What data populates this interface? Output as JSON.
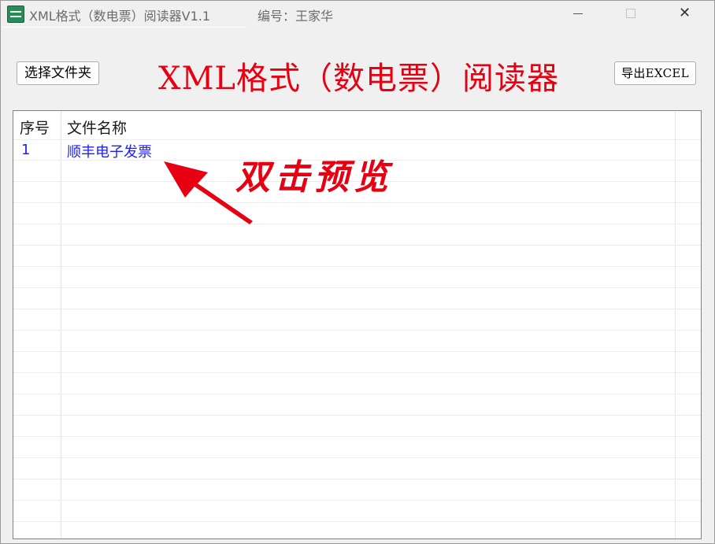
{
  "window": {
    "title": "XML格式（数电票）阅读器V1.1",
    "author": "编号：王家华",
    "controls": {
      "minimize": "—",
      "maximize": "□",
      "close": "✕"
    }
  },
  "toolbar": {
    "folder_button": "选择文件夹",
    "heading": "XML格式（数电票）阅读器",
    "export_button": "导出EXCEL"
  },
  "table": {
    "columns": [
      "序号",
      "文件名称"
    ],
    "rows": [
      {
        "no": "1",
        "name": "顺丰电子发票"
      }
    ]
  },
  "annotation": {
    "text": "双击预览",
    "color": "#e60012"
  },
  "icons": [
    "app-icon",
    "minimize-icon",
    "maximize-icon",
    "close-icon",
    "arrow-icon"
  ]
}
